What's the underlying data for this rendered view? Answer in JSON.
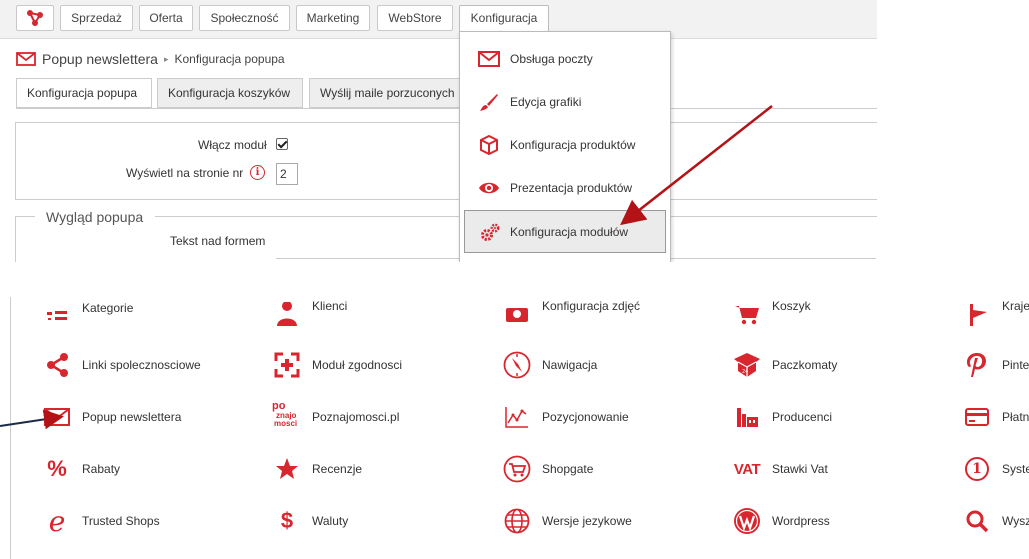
{
  "nav": {
    "items": [
      "Sprzedaż",
      "Oferta",
      "Społeczność",
      "Marketing",
      "WebStore",
      "Konfiguracja"
    ]
  },
  "breadcrumb": {
    "title": "Popup newslettera",
    "separator": "▸",
    "current": "Konfiguracja popupa"
  },
  "tabs": [
    "Konfiguracja popupa",
    "Konfiguracja koszyków",
    "Wyślij maile porzuconych"
  ],
  "form": {
    "enable_label": "Włącz moduł",
    "page_label": "Wyświetl na stronie nr",
    "page_value": "2",
    "section_legend": "Wygląd popupa",
    "text_label": "Tekst nad formem"
  },
  "dropdown": {
    "items": [
      "Obsługa poczty",
      "Edycja grafiki",
      "Konfiguracja produktów",
      "Prezentacja produktów",
      "Konfiguracja modułów"
    ]
  },
  "modules": {
    "row0": [
      "Kategorie",
      "Klienci",
      "Konfiguracja zdjęć",
      "Koszyk",
      "Kraje"
    ],
    "row1": [
      "Linki spolecznosciowe",
      "Moduł zgodnosci",
      "Nawigacja",
      "Paczkomaty",
      "Pinterest"
    ],
    "row2": [
      "Popup newslettera",
      "Poznajomosci.pl",
      "Pozycjonowanie",
      "Producenci",
      "Płatności"
    ],
    "row3": [
      "Rabaty",
      "Recenzje",
      "Shopgate",
      "Stawki Vat",
      "System punktowy"
    ],
    "row4": [
      "Trusted Shops",
      "Waluty",
      "Wersje jezykowe",
      "Wordpress",
      "Wyszukiwarka"
    ],
    "icon_texts": {
      "poznajomosci": [
        "po",
        "znajo",
        "mosci"
      ],
      "vat": "VAT",
      "percent": "%",
      "dollar": "$",
      "one": "1",
      "trusted": "e"
    }
  },
  "colors": {
    "accent": "#d8262f",
    "arrow": "#b31217"
  }
}
